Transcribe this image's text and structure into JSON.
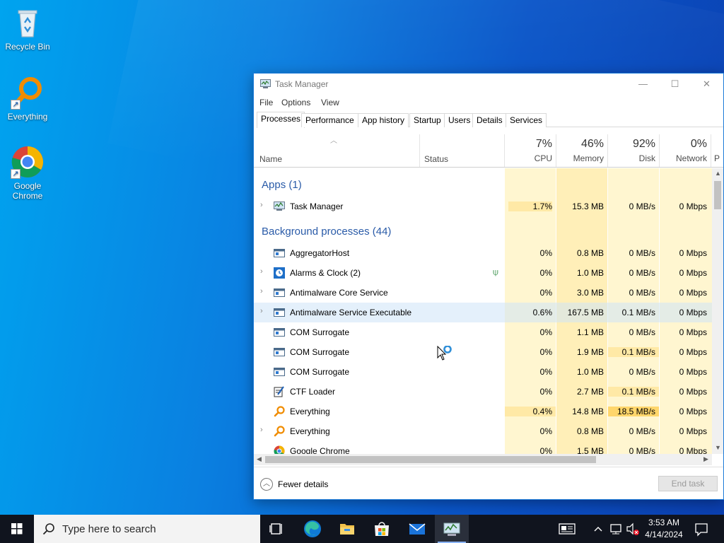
{
  "desktop": {
    "icons": [
      {
        "label": "Recycle Bin"
      },
      {
        "label": "Everything"
      },
      {
        "label": "Google Chrome"
      }
    ]
  },
  "window": {
    "title": "Task Manager",
    "controls": {
      "minimize": "—",
      "maximize": "☐",
      "close": "✕"
    },
    "menu": [
      "File",
      "Options",
      "View"
    ],
    "tabs": [
      "Processes",
      "Performance",
      "App history",
      "Startup",
      "Users",
      "Details",
      "Services"
    ],
    "active_tab": "Processes",
    "columns": {
      "name": "Name",
      "status": "Status",
      "cpu": {
        "pct": "7%",
        "label": "CPU"
      },
      "memory": {
        "pct": "46%",
        "label": "Memory"
      },
      "disk": {
        "pct": "92%",
        "label": "Disk"
      },
      "network": {
        "pct": "0%",
        "label": "Network"
      },
      "next_col_partial": "P"
    },
    "groups": {
      "apps": "Apps (1)",
      "background": "Background processes (44)"
    },
    "apps": [
      {
        "name": "Task Manager",
        "cpu": "1.7%",
        "memory": "15.3 MB",
        "disk": "0 MB/s",
        "network": "0 Mbps",
        "expandable": true,
        "icon": "task-manager-icon"
      }
    ],
    "processes": [
      {
        "name": "AggregatorHost",
        "cpu": "0%",
        "memory": "0.8 MB",
        "disk": "0 MB/s",
        "network": "0 Mbps",
        "expandable": false,
        "icon": "service-window-icon"
      },
      {
        "name": "Alarms & Clock (2)",
        "cpu": "0%",
        "memory": "1.0 MB",
        "disk": "0 MB/s",
        "network": "0 Mbps",
        "expandable": true,
        "icon": "alarm-clock-icon",
        "status_icon": "leaf-icon"
      },
      {
        "name": "Antimalware Core Service",
        "cpu": "0%",
        "memory": "3.0 MB",
        "disk": "0 MB/s",
        "network": "0 Mbps",
        "expandable": true,
        "icon": "service-window-icon"
      },
      {
        "name": "Antimalware Service Executable",
        "cpu": "0.6%",
        "memory": "167.5 MB",
        "disk": "0.1 MB/s",
        "network": "0 Mbps",
        "expandable": true,
        "icon": "service-window-icon",
        "selected": true
      },
      {
        "name": "COM Surrogate",
        "cpu": "0%",
        "memory": "1.1 MB",
        "disk": "0 MB/s",
        "network": "0 Mbps",
        "expandable": false,
        "icon": "service-window-icon"
      },
      {
        "name": "COM Surrogate",
        "cpu": "0%",
        "memory": "1.9 MB",
        "disk": "0.1 MB/s",
        "network": "0 Mbps",
        "expandable": false,
        "icon": "service-window-icon"
      },
      {
        "name": "COM Surrogate",
        "cpu": "0%",
        "memory": "1.0 MB",
        "disk": "0 MB/s",
        "network": "0 Mbps",
        "expandable": false,
        "icon": "service-window-icon"
      },
      {
        "name": "CTF Loader",
        "cpu": "0%",
        "memory": "2.7 MB",
        "disk": "0.1 MB/s",
        "network": "0 Mbps",
        "expandable": false,
        "icon": "pen-notepad-icon"
      },
      {
        "name": "Everything",
        "cpu": "0.4%",
        "memory": "14.8 MB",
        "disk": "18.5 MB/s",
        "network": "0 Mbps",
        "expandable": false,
        "icon": "everything-search-icon"
      },
      {
        "name": "Everything",
        "cpu": "0%",
        "memory": "0.8 MB",
        "disk": "0 MB/s",
        "network": "0 Mbps",
        "expandable": true,
        "icon": "everything-search-icon"
      },
      {
        "name": "Google Chrome",
        "cpu": "0%",
        "memory": "1.5 MB",
        "disk": "0 MB/s",
        "network": "0 Mbps",
        "expandable": false,
        "icon": "chrome-icon"
      }
    ],
    "footer": {
      "fewer_details": "Fewer details",
      "end_task": "End task"
    }
  },
  "taskbar": {
    "search_placeholder": "Type here to search",
    "pinned": [
      "task-view-icon",
      "edge-icon",
      "file-explorer-icon",
      "store-icon",
      "mail-icon",
      "task-manager-icon"
    ],
    "clock": {
      "time": "3:53 AM",
      "date": "4/14/2024"
    }
  },
  "colors": {
    "heat_light": "#fff4c4",
    "heat_mid": "#ffeaa0",
    "heat_strong": "#ffd66b",
    "accent_blue": "#2a5ba8",
    "taskbar": "#10141e"
  }
}
